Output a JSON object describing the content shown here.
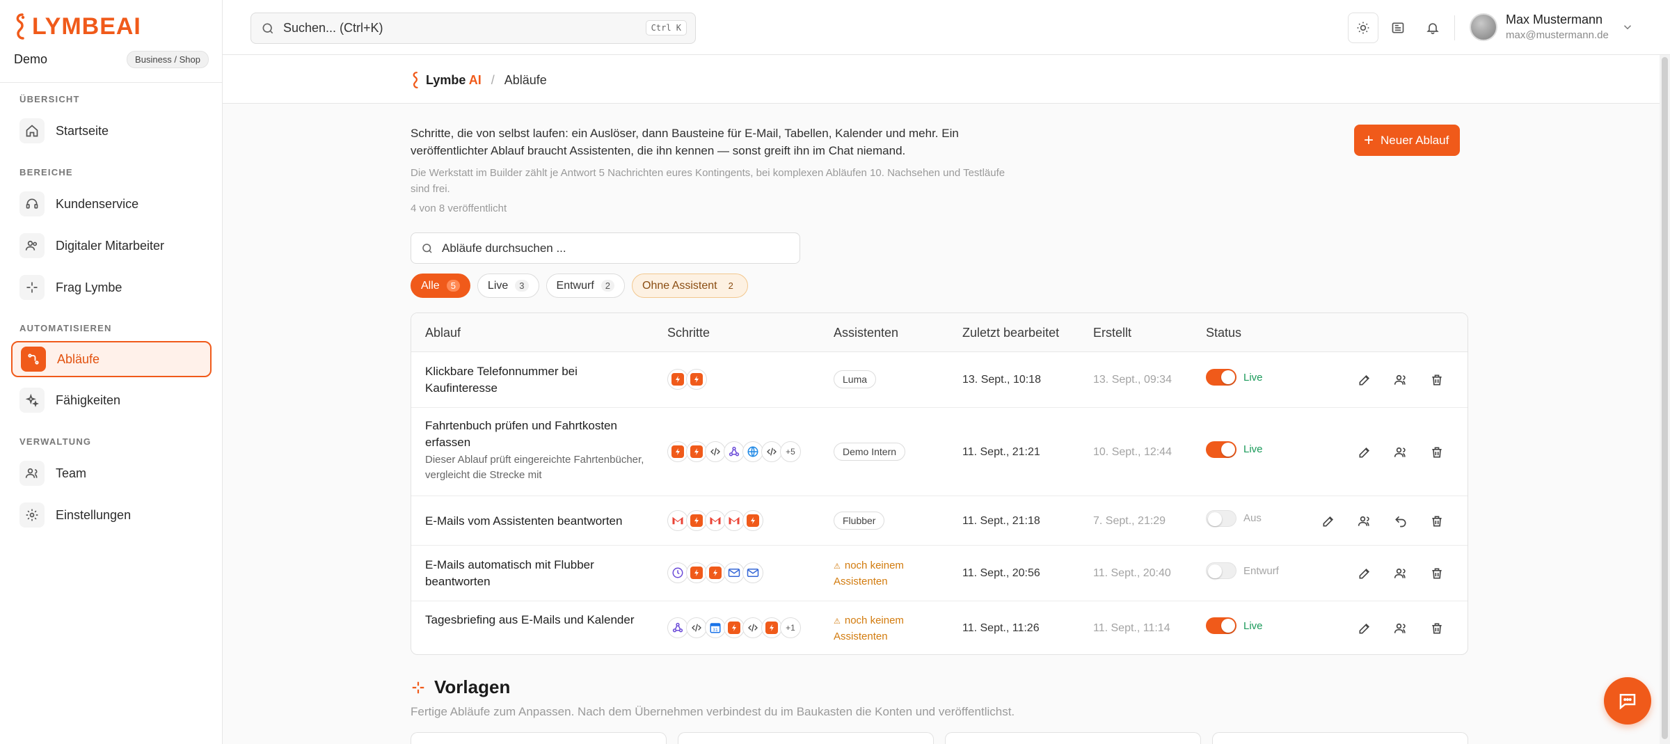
{
  "brand": {
    "logo_text": "LYMBEAI",
    "accent": "#f05a1a"
  },
  "workspace": {
    "name": "Demo",
    "badge": "Business / Shop"
  },
  "sidebar": {
    "sections": [
      {
        "label": "ÜBERSICHT",
        "items": [
          {
            "label": "Startseite",
            "icon": "home-icon"
          }
        ]
      },
      {
        "label": "BEREICHE",
        "items": [
          {
            "label": "Kundenservice",
            "icon": "headset-icon"
          },
          {
            "label": "Digitaler Mitarbeiter",
            "icon": "users-icon"
          },
          {
            "label": "Frag Lymbe",
            "icon": "sparkle-icon"
          }
        ]
      },
      {
        "label": "AUTOMATISIEREN",
        "items": [
          {
            "label": "Abläufe",
            "icon": "workflow-icon",
            "active": true
          },
          {
            "label": "Fähigkeiten",
            "icon": "magic-icon"
          }
        ]
      },
      {
        "label": "VERWALTUNG",
        "items": [
          {
            "label": "Team",
            "icon": "team-icon"
          },
          {
            "label": "Einstellungen",
            "icon": "gear-icon"
          }
        ]
      }
    ]
  },
  "topbar": {
    "search_placeholder": "Suchen... (Ctrl+K)",
    "shortcut": "Ctrl K",
    "icons": [
      "sun-icon",
      "news-icon",
      "bell-icon"
    ],
    "user": {
      "name": "Max Mustermann",
      "email": "max@mustermann.de"
    }
  },
  "breadcrumb": {
    "logo_a": "Lymbe",
    "logo_b": "AI",
    "separator": "/",
    "current": "Abläufe"
  },
  "main": {
    "intro": "Schritte, die von selbst laufen: ein Auslöser, dann Bausteine für E-Mail, Tabellen, Kalender und mehr. Ein veröffentlichter Ablauf braucht Assistenten, die ihn kennen — sonst greift ihn im Chat niemand.",
    "note": "Die Werkstatt im Builder zählt je Antwort 5 Nachrichten eures Kontingents, bei komplexen Abläufen 10. Nachsehen und Testläufe sind frei.",
    "count": "4 von 8 veröffentlicht",
    "new_button": "Neuer Ablauf",
    "search_placeholder": "Abläufe durchsuchen ...",
    "filters": [
      {
        "label": "Alle",
        "count": "5",
        "state": "active"
      },
      {
        "label": "Live",
        "count": "3",
        "state": "normal"
      },
      {
        "label": "Entwurf",
        "count": "2",
        "state": "normal"
      },
      {
        "label": "Ohne Assistent",
        "count": "2",
        "state": "warn"
      }
    ],
    "columns": [
      "Ablauf",
      "Schritte",
      "Assistenten",
      "Zuletzt bearbeitet",
      "Erstellt",
      "Status"
    ],
    "rows": [
      {
        "title": "Klickbare Telefonnummer bei Kaufinteresse",
        "desc": "",
        "steps": [
          "lymbe-icon",
          "lymbe-icon"
        ],
        "more": "",
        "assistant": "Luma",
        "assistant_warn": false,
        "edited": "13. Sept., 10:18",
        "created": "13. Sept., 09:34",
        "status": "Live",
        "on": true,
        "actions": [
          "edit-icon",
          "assign-users-icon",
          "delete-icon"
        ]
      },
      {
        "title": "Fahrtenbuch prüfen und Fahrtkosten erfassen",
        "desc": "Dieser Ablauf prüft eingereichte Fahrtenbücher, vergleicht die Strecke mit",
        "steps": [
          "lymbe-icon",
          "lymbe-icon",
          "code-icon",
          "webhook-icon",
          "globe-icon",
          "code-icon"
        ],
        "more": "+5",
        "assistant": "Demo Intern",
        "assistant_warn": false,
        "edited": "11. Sept., 21:21",
        "created": "10. Sept., 12:44",
        "status": "Live",
        "on": true,
        "actions": [
          "edit-icon",
          "assign-users-icon",
          "delete-icon"
        ]
      },
      {
        "title": "E-Mails vom Assistenten beantworten",
        "desc": "",
        "steps": [
          "gmail-icon",
          "lymbe-icon",
          "gmail-icon",
          "gmail-icon",
          "lymbe-icon"
        ],
        "more": "",
        "assistant": "Flubber",
        "assistant_warn": false,
        "edited": "11. Sept., 21:18",
        "created": "7. Sept., 21:29",
        "status": "Aus",
        "on": false,
        "actions": [
          "edit-icon",
          "assign-users-icon",
          "undo-icon",
          "delete-icon"
        ]
      },
      {
        "title": "E-Mails automatisch mit Flubber beantworten",
        "desc": "",
        "steps": [
          "clock-icon",
          "lymbe-icon",
          "lymbe-icon",
          "mail-icon",
          "mail-icon"
        ],
        "more": "",
        "assistant": "noch keinem Assistenten",
        "assistant_warn": true,
        "edited": "11. Sept., 20:56",
        "created": "11. Sept., 20:40",
        "status": "Entwurf",
        "on": false,
        "actions": [
          "edit-icon",
          "assign-users-icon",
          "delete-icon"
        ]
      },
      {
        "title": "Tagesbriefing aus E-Mails und Kalender",
        "desc": "",
        "steps": [
          "webhook-icon",
          "code-icon",
          "calendar-icon",
          "lymbe-icon",
          "code-icon",
          "lymbe-icon"
        ],
        "more": "+1",
        "assistant": "noch keinem Assistenten",
        "assistant_warn": true,
        "edited": "11. Sept., 11:26",
        "created": "11. Sept., 11:14",
        "status": "Live",
        "on": true,
        "actions": [
          "edit-icon",
          "assign-users-icon",
          "delete-icon"
        ]
      }
    ],
    "templates": {
      "title": "Vorlagen",
      "subtitle": "Fertige Abläufe zum Anpassen. Nach dem Übernehmen verbindest du im Baukasten die Konten und veröffentlichst."
    }
  }
}
